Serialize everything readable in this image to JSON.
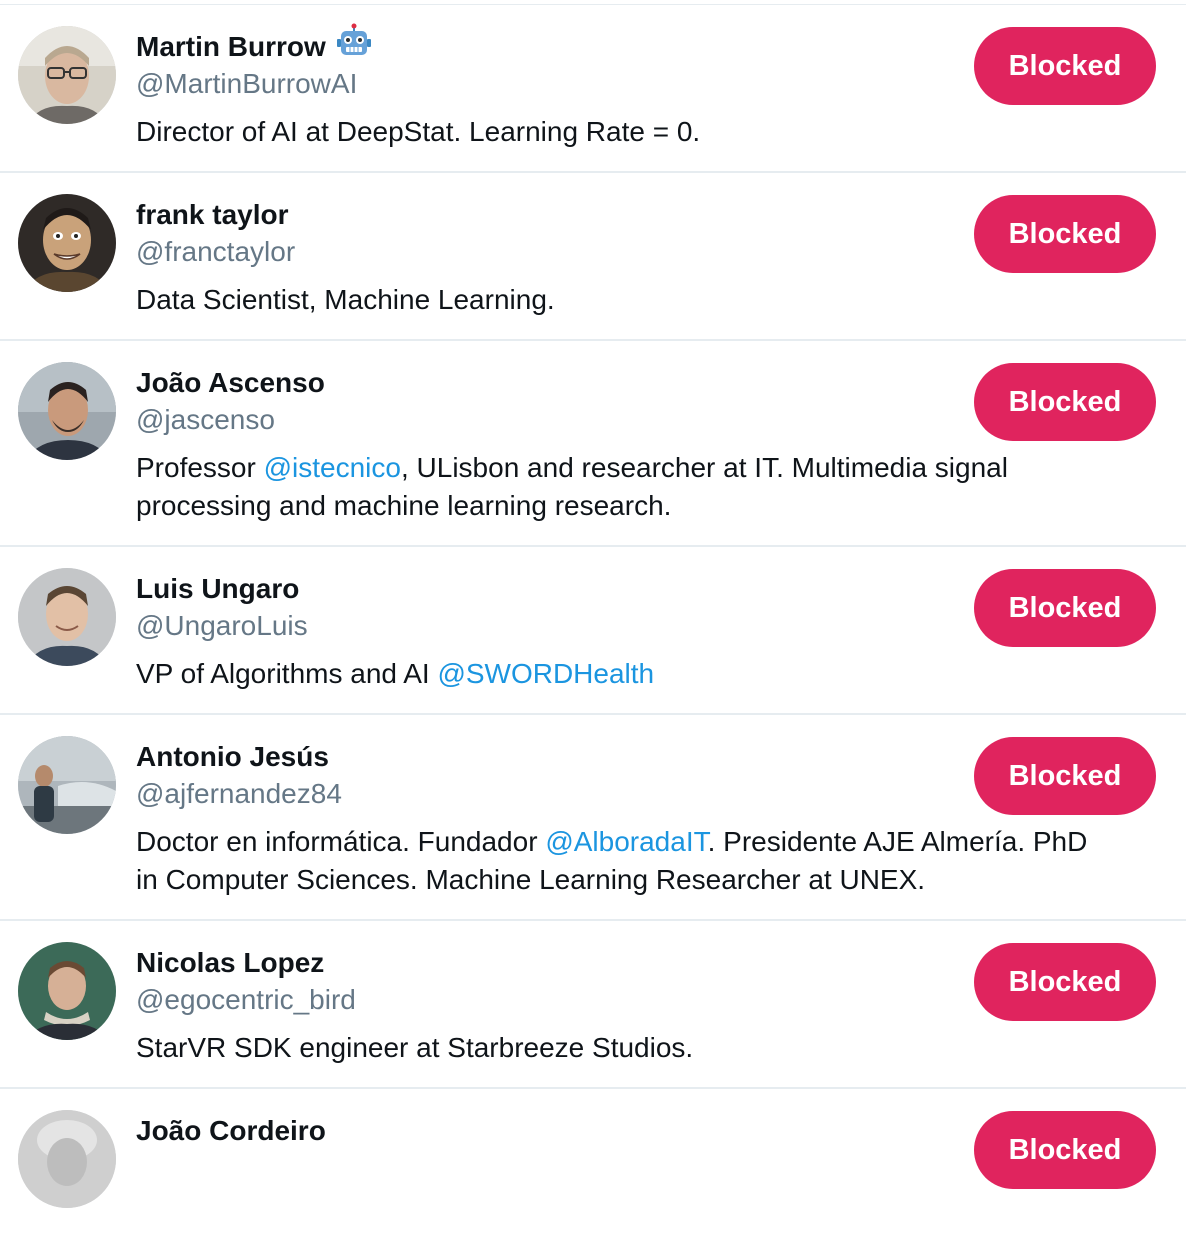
{
  "users": [
    {
      "name": "Martin Burrow",
      "handle": "@MartinBurrowAI",
      "has_robot_emoji": true,
      "bio_parts": [
        {
          "text": "Director of AI at DeepStat. Learning Rate = 0.",
          "mention": false
        }
      ],
      "button_label": "Blocked",
      "avatar_bg": "#c9c4b8"
    },
    {
      "name": "frank taylor",
      "handle": "@franctaylor",
      "bio_parts": [
        {
          "text": "Data Scientist, Machine Learning.",
          "mention": false
        }
      ],
      "button_label": "Blocked",
      "avatar_bg": "#4a4440"
    },
    {
      "name": "João Ascenso",
      "handle": "@jascenso",
      "bio_parts": [
        {
          "text": "Professor ",
          "mention": false
        },
        {
          "text": "@istecnico",
          "mention": true
        },
        {
          "text": ", ULisbon and researcher at IT. Multimedia signal processing and machine learning research.",
          "mention": false
        }
      ],
      "button_label": "Blocked",
      "avatar_bg": "#8f9aa3"
    },
    {
      "name": "Luis Ungaro",
      "handle": "@UngaroLuis",
      "bio_parts": [
        {
          "text": "VP of Algorithms and AI ",
          "mention": false
        },
        {
          "text": "@SWORDHealth",
          "mention": true
        }
      ],
      "button_label": "Blocked",
      "avatar_bg": "#bfc2c4"
    },
    {
      "name": "Antonio Jesús",
      "handle": "@ajfernandez84",
      "bio_parts": [
        {
          "text": "Doctor en informática. Fundador ",
          "mention": false
        },
        {
          "text": "@AlboradaIT",
          "mention": true
        },
        {
          "text": ". Presidente AJE Almería. PhD in Computer Sciences. Machine Learning Researcher at UNEX.",
          "mention": false
        }
      ],
      "button_label": "Blocked",
      "avatar_bg": "#9aa3a8"
    },
    {
      "name": "Nicolas Lopez",
      "handle": "@egocentric_bird",
      "bio_parts": [
        {
          "text": "StarVR SDK engineer at Starbreeze Studios.",
          "mention": false
        }
      ],
      "button_label": "Blocked",
      "avatar_bg": "#3f6b5a"
    },
    {
      "name": "João Cordeiro",
      "handle": "",
      "bio_parts": [],
      "button_label": "Blocked",
      "avatar_bg": "#c8c8c8"
    }
  ],
  "colors": {
    "blocked_button": "#e0245e",
    "mention": "#1b95e0",
    "handle": "#657786",
    "divider": "#e6ecf0"
  }
}
